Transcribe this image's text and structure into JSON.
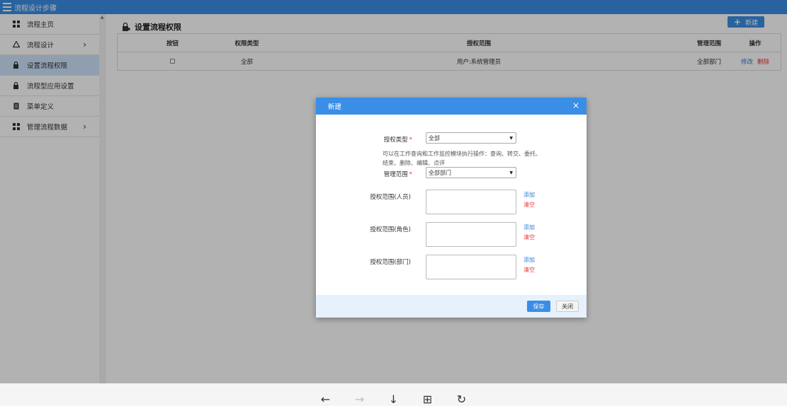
{
  "window": {
    "title": "流程设计步骤"
  },
  "sidebar": {
    "items": [
      {
        "label": "流程主页",
        "icon": "puzzle-icon"
      },
      {
        "label": "流程设计",
        "icon": "cycle-icon",
        "arrow": "›"
      },
      {
        "label": "设置流程权限",
        "icon": "lock-icon"
      },
      {
        "label": "流程型应用设置",
        "icon": "lock-icon"
      },
      {
        "label": "菜单定义",
        "icon": "document-icon"
      },
      {
        "label": "管理流程数据",
        "icon": "grid-icon",
        "arrow": "›"
      }
    ],
    "active_index": 2
  },
  "page": {
    "title": "设置流程权限",
    "new_button": "新建"
  },
  "table": {
    "headers": [
      "按钮",
      "权限类型",
      "授权范围",
      "管理范围",
      "操作"
    ],
    "rows": [
      {
        "type": "全部",
        "scope": "用户:系统管理员",
        "manage": "全部部门",
        "edit": "修改",
        "delete": "删除"
      }
    ]
  },
  "modal": {
    "title": "新建",
    "close": "×",
    "auth_type_label": "授权类型",
    "required_mark": "*",
    "auth_type_value": "全部",
    "hint": "可以在工作查询和工作监控模块执行操作：查询、转交、委托、结束、删除、编辑、点评",
    "manage_scope_label": "管理范围",
    "manage_scope_value": "全部部门",
    "scope_person_label": "授权范围(人员)",
    "scope_role_label": "授权范围(角色)",
    "scope_dept_label": "授权范围(部门)",
    "add_label": "添加",
    "clear_label": "清空",
    "save_button": "保存",
    "close_button": "关闭"
  },
  "bottom_nav": {
    "back": "←",
    "forward": "→",
    "download": "↓",
    "page": "⊞",
    "refresh": "↻"
  },
  "colors": {
    "primary": "#3a8ee6",
    "danger": "#e53935",
    "link": "#2f7bd8",
    "active_bg": "#cfe4fb"
  }
}
